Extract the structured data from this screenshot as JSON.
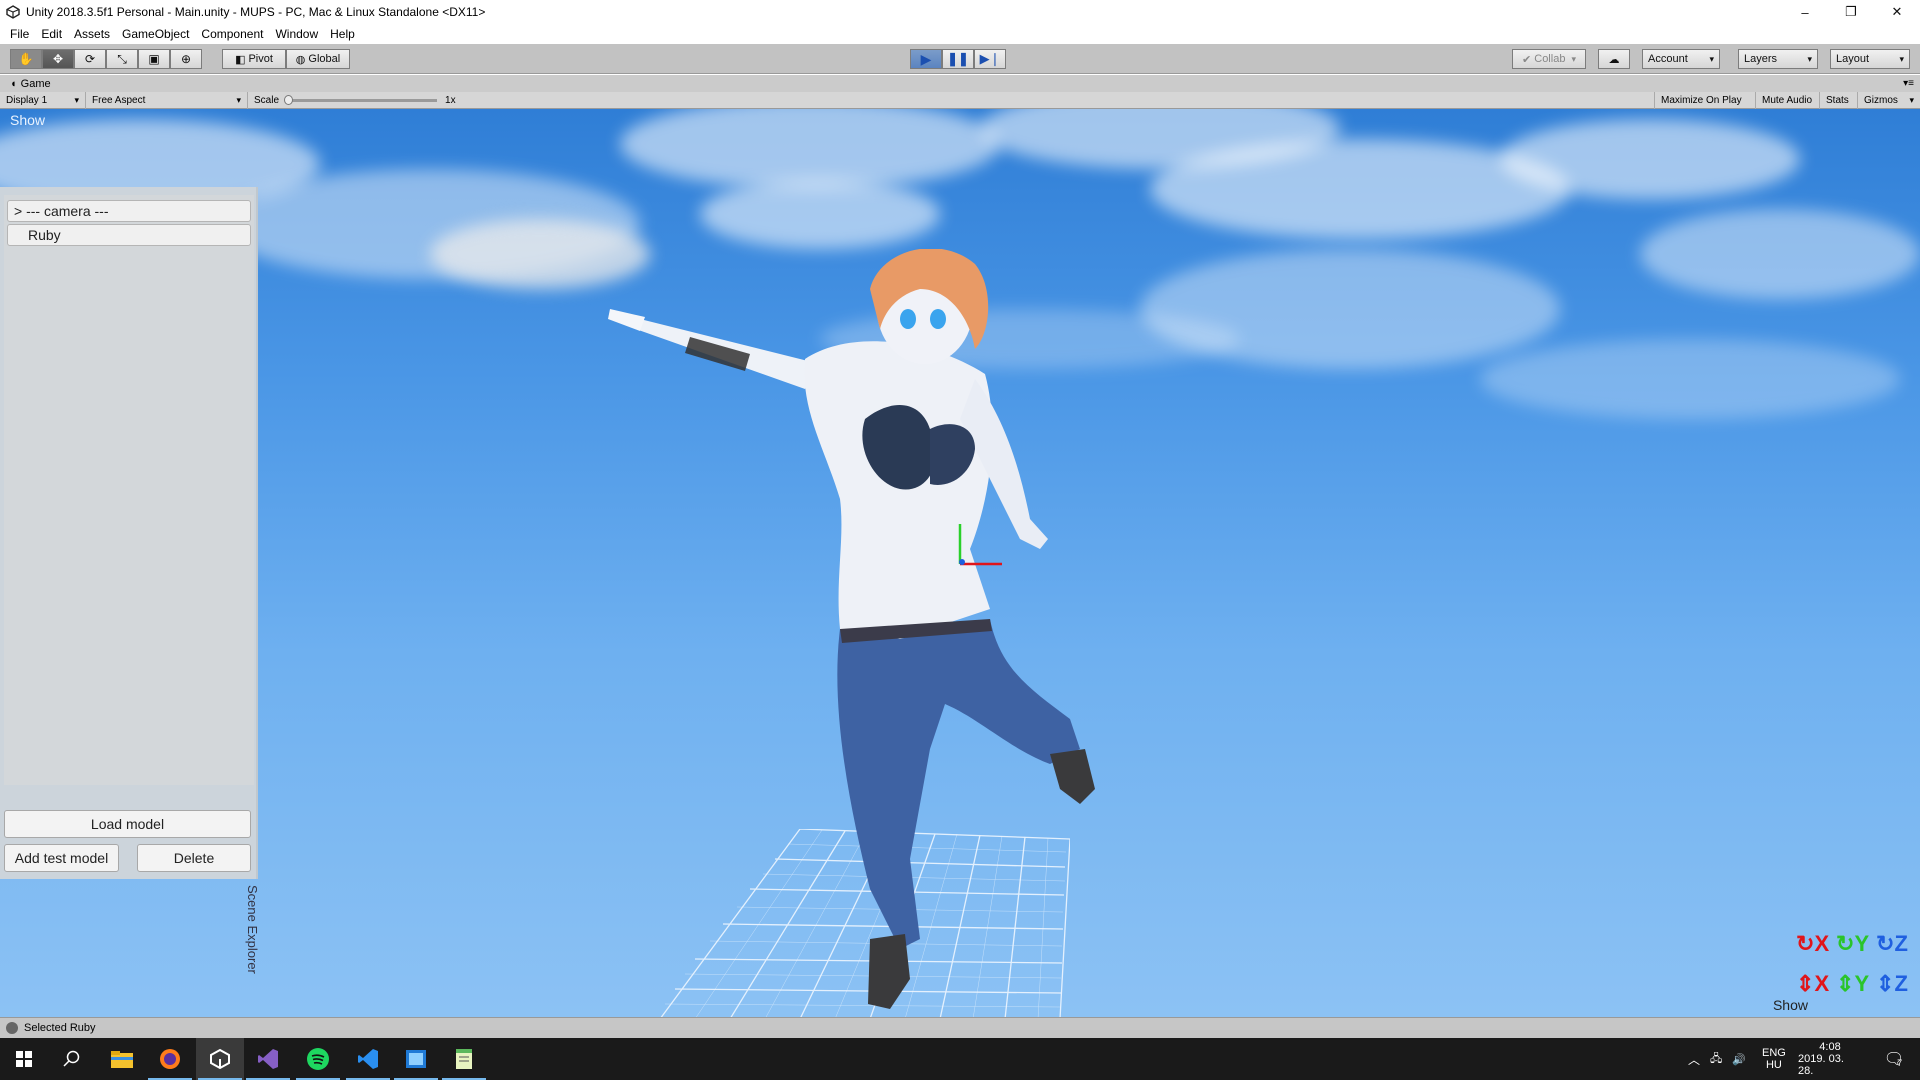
{
  "window": {
    "title": "Unity 2018.3.5f1 Personal - Main.unity - MUPS - PC, Mac & Linux Standalone <DX11>",
    "minimize": "–",
    "maximize": "❐",
    "close": "✕"
  },
  "menu": [
    "File",
    "Edit",
    "Assets",
    "GameObject",
    "Component",
    "Window",
    "Help"
  ],
  "toolbar": {
    "pivot": "Pivot",
    "global": "Global",
    "collab": "Collab",
    "account": "Account",
    "layers": "Layers",
    "layout": "Layout"
  },
  "game_tab": {
    "title": "Game",
    "display": "Display 1",
    "aspect": "Free Aspect",
    "scale_label": "Scale",
    "scale_value": "1x",
    "maximize_on_play": "Maximize On Play",
    "mute_audio": "Mute Audio",
    "stats": "Stats",
    "gizmos": "Gizmos"
  },
  "viewport": {
    "show_top": "Show",
    "show_bottom": "Show",
    "scene_explorer_label": "Scene Explorer",
    "items": [
      "> --- camera ---",
      "Ruby"
    ],
    "load_model": "Load model",
    "add_test_model": "Add test model",
    "delete": "Delete",
    "axis_rotate": [
      "X",
      "Y",
      "Z"
    ],
    "axis_move": [
      "X",
      "Y",
      "Z"
    ]
  },
  "status": {
    "text": "Selected Ruby"
  },
  "taskbar": {
    "lang_top": "ENG",
    "lang_bottom": "HU",
    "time": "4:08",
    "date": "2019. 03. 28.",
    "notifications": "7"
  },
  "colors": {
    "x_axis": "#e0151b",
    "y_axis": "#2ac42a",
    "z_axis": "#1f5fe0",
    "play_active": "#5b84c0"
  }
}
